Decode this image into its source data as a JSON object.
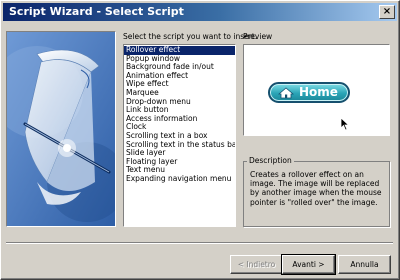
{
  "window": {
    "title": "Script Wizard - Select Script",
    "close_glyph": "×"
  },
  "list": {
    "prompt": "Select the script you want to insert.",
    "items": [
      "Rollover effect",
      "Popup window",
      "Background fade in/out",
      "Animation effect",
      "Wipe effect",
      "Marquee",
      "Drop-down menu",
      "Link button",
      "Access information",
      "Clock",
      "Scrolling text in a box",
      "Scrolling text in the status bar",
      "Slide layer",
      "Floating layer",
      "Text menu",
      "Expanding navigation menu"
    ],
    "selected_index": 0
  },
  "preview": {
    "label": "Preview",
    "button_label": "Home",
    "button_icon": "house-icon",
    "cursor_icon": "arrow-cursor-icon"
  },
  "description": {
    "label": "Description",
    "text": "Creates a rollover effect on an image. The image will be replaced by another image when the mouse pointer is \"rolled over\" the image."
  },
  "buttons": {
    "back": "< Indietro",
    "next": "Avanti >",
    "cancel": "Annulla"
  },
  "colors": {
    "titlebar_start": "#0a246a",
    "titlebar_end": "#a6caf0",
    "selection": "#0a246a",
    "art_background": "#4f7fc1",
    "home_button": "#2aa4b6"
  }
}
